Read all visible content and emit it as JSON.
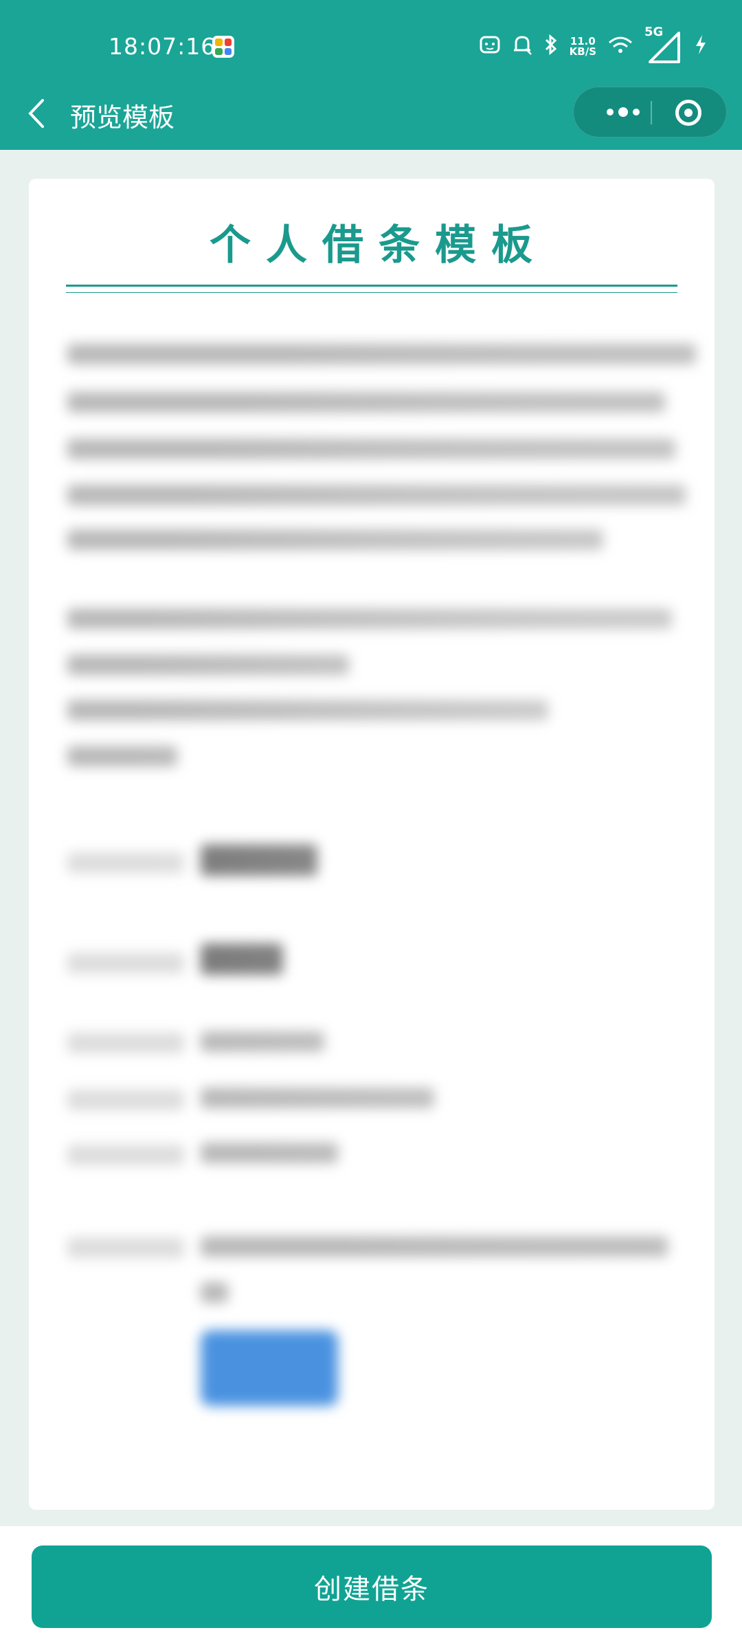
{
  "status_bar": {
    "time": "18:07:16",
    "net_speed_value": "11.0",
    "net_speed_unit": "KB/S",
    "network_type": "5G"
  },
  "nav": {
    "title": "预览模板"
  },
  "document": {
    "title": "个人借条模板"
  },
  "actions": {
    "create_label": "创建借条"
  },
  "colors": {
    "brand_green": "#1aa596",
    "button_green": "#10a393",
    "title_green": "#1a9a8d",
    "page_background": "#e9f1ef"
  }
}
